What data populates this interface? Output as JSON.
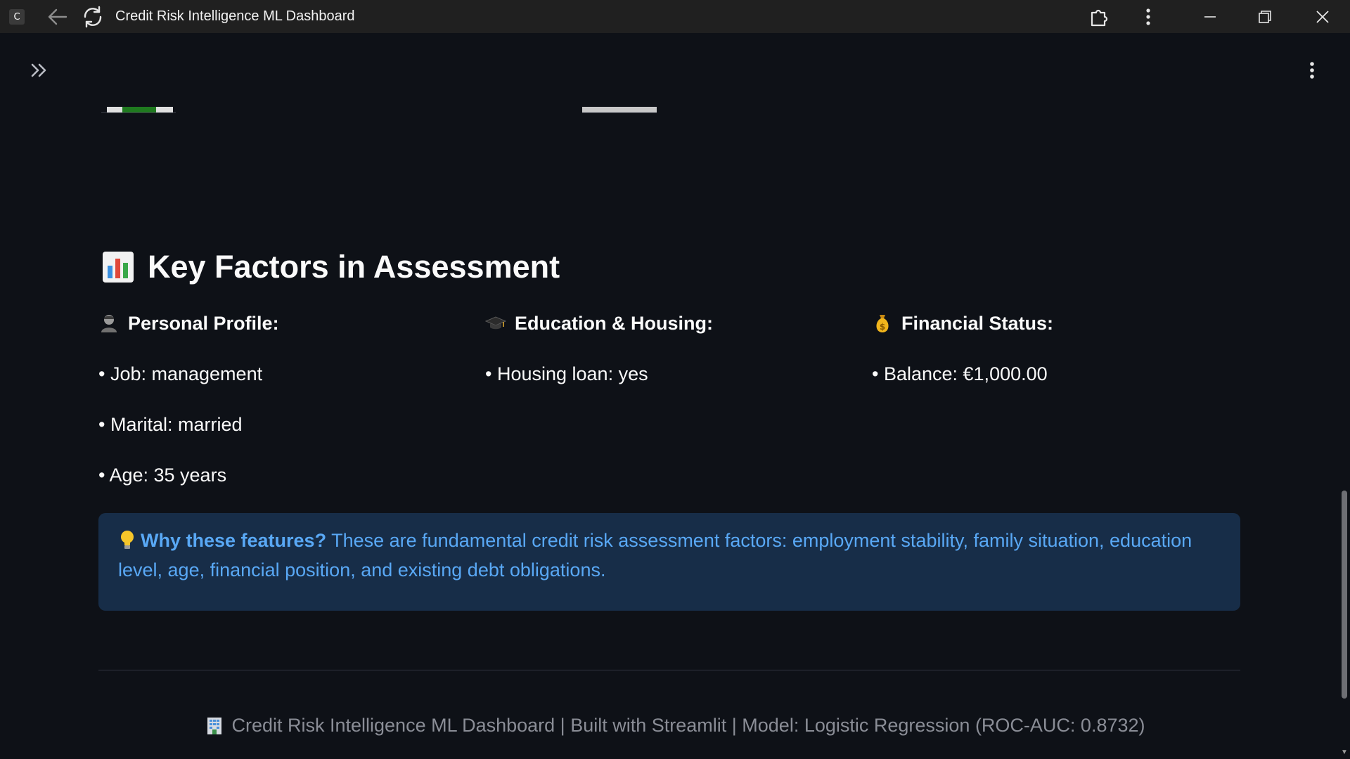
{
  "window": {
    "app_icon_letter": "C",
    "title": "Credit Risk Intelligence ML Dashboard"
  },
  "icons": {
    "app": "app-icon",
    "back": "arrow-left-icon",
    "reload": "reload-icon",
    "extensions": "puzzle-icon",
    "more": "vertical-dots-icon",
    "minimize": "minimize-icon",
    "maximize": "restore-icon",
    "close": "close-icon",
    "sidebar_toggle": "double-chevron-right-icon",
    "main_menu": "vertical-dots-icon"
  },
  "section": {
    "heading": "Key Factors in Assessment",
    "heading_icon": "bar-chart-emoji-icon"
  },
  "columns": {
    "personal": {
      "icon": "person-emoji-icon",
      "title": "Personal Profile:",
      "items": [
        "• Job: management",
        "• Marital: married",
        "• Age: 35 years"
      ]
    },
    "education": {
      "icon": "graduation-cap-emoji-icon",
      "title": "Education & Housing:",
      "items": [
        "• Housing loan: yes"
      ]
    },
    "financial": {
      "icon": "money-bag-emoji-icon",
      "title": "Financial Status:",
      "items": [
        "• Balance: €1,000.00"
      ]
    }
  },
  "info": {
    "icon": "light-bulb-emoji-icon",
    "strong": "Why these features?",
    "text": "These are fundamental credit risk assessment factors: employment stability, family situation, education level, age, financial position, and existing debt obligations."
  },
  "footer": {
    "icon": "office-building-emoji-icon",
    "text": "Credit Risk Intelligence ML Dashboard | Built with Streamlit | Model: Logistic Regression (ROC-AUC: 0.8732)"
  },
  "colors": {
    "background": "#0e1117",
    "titlebar": "#202020",
    "info_bg": "#172d48",
    "info_text": "#59a8f5",
    "footer_text": "#8a8d96"
  }
}
